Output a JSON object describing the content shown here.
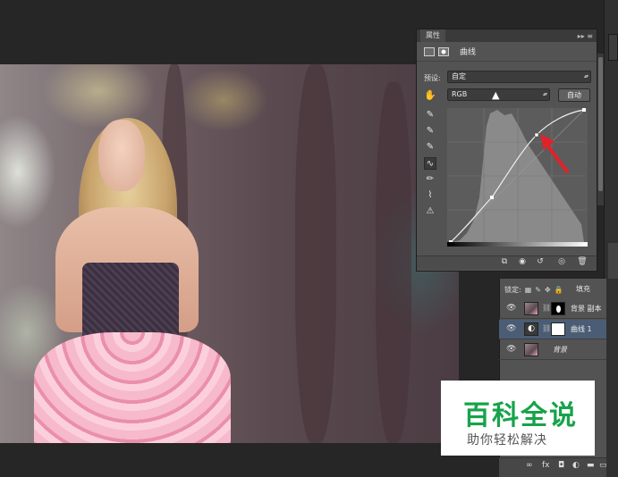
{
  "properties_panel": {
    "tab_label": "属性",
    "collapse_glyph": "▸▸",
    "menu_glyph": "≡",
    "title": "曲线",
    "preset_label": "预设:",
    "preset_value": "自定",
    "channel_value": "RGB",
    "auto_label": "自动"
  },
  "layers_panel": {
    "lock_label": "锁定:",
    "fill_label": "填充",
    "layers": [
      {
        "name": "背景 副本",
        "type": "photo-with-mask",
        "visible": true,
        "active": false
      },
      {
        "name": "曲线 1",
        "type": "curves-adjustment",
        "visible": true,
        "active": true
      },
      {
        "name": "背景",
        "type": "photo",
        "visible": true,
        "active": false
      }
    ]
  },
  "watermark": {
    "title": "百科全说",
    "subtitle": "助你轻松解决",
    "color": "#17a34a"
  },
  "icons": {
    "eye": "eye-icon",
    "chain": "chain-link-icon",
    "hand": "hand-icon",
    "curve_tool": "curve-icon"
  },
  "accent_colors": {
    "arrow": "#e0222a",
    "active_layer": "#4b5d75"
  }
}
